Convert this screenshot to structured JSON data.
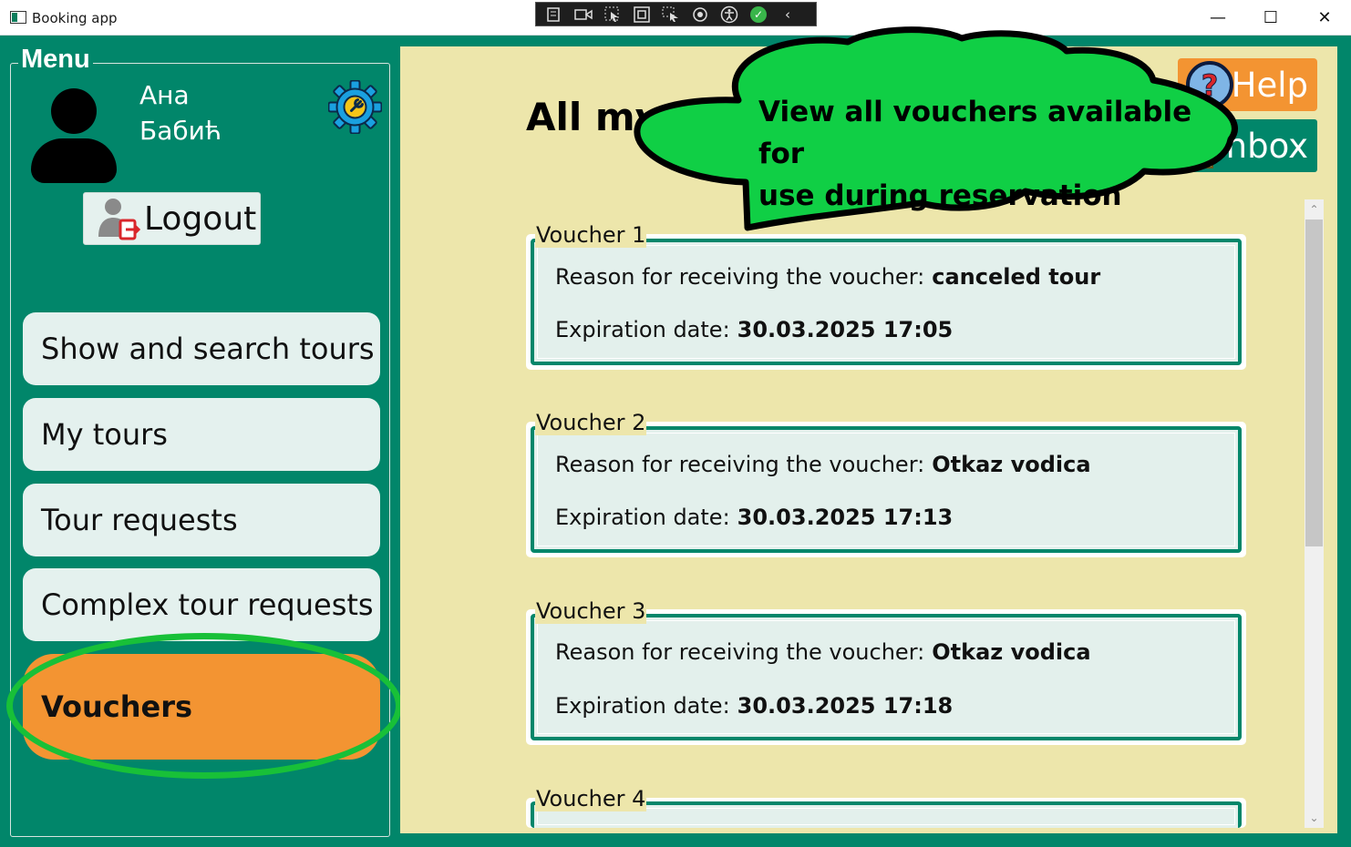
{
  "window": {
    "title": "Booking app",
    "controls": {
      "minimize": "—",
      "maximize": "☐",
      "close": "✕"
    }
  },
  "debug_toolbar": {
    "icons": [
      "live-visual-tree-icon",
      "record-icon",
      "select-element-icon",
      "display-layout-adorners-icon",
      "track-focus-icon",
      "binding-failures-icon",
      "accessibility-icon",
      "check-icon",
      "collapse-icon"
    ],
    "check": "✓",
    "collapse": "‹"
  },
  "sidebar": {
    "menu_title": "Menu",
    "user": {
      "first_name": "Ана",
      "last_name": "Бабић"
    },
    "logout_label": "Logout",
    "nav": [
      {
        "label": "Show and search tours",
        "active": false
      },
      {
        "label": "My tours",
        "active": false
      },
      {
        "label": "Tour requests",
        "active": false
      },
      {
        "label": "Complex tour requests",
        "active": false
      },
      {
        "label": "Vouchers",
        "active": true
      }
    ]
  },
  "header": {
    "title": "All my",
    "help_label": "Help",
    "inbox_label": "Inbox"
  },
  "callout": {
    "line1": "View all vouchers available for",
    "line2": "use during reservation"
  },
  "vouchers": [
    {
      "title": "Voucher 1",
      "reason_label": "Reason for receiving the voucher:",
      "reason": "canceled tour",
      "expiration_label": "Expiration date:",
      "expiration": "30.03.2025 17:05"
    },
    {
      "title": "Voucher 2",
      "reason_label": "Reason for receiving the voucher:",
      "reason": "Otkaz vodica",
      "expiration_label": "Expiration date:",
      "expiration": "30.03.2025 17:13"
    },
    {
      "title": "Voucher 3",
      "reason_label": "Reason for receiving the voucher:",
      "reason": "Otkaz vodica",
      "expiration_label": "Expiration date:",
      "expiration": "30.03.2025 17:18"
    },
    {
      "title": "Voucher 4"
    }
  ],
  "scrollbar": {
    "up": "⌃",
    "down": "⌄"
  },
  "colors": {
    "brand_green": "#01866a",
    "accent_orange": "#f39432",
    "content_bg": "#ede6ab",
    "highlight_green": "#18c038"
  }
}
